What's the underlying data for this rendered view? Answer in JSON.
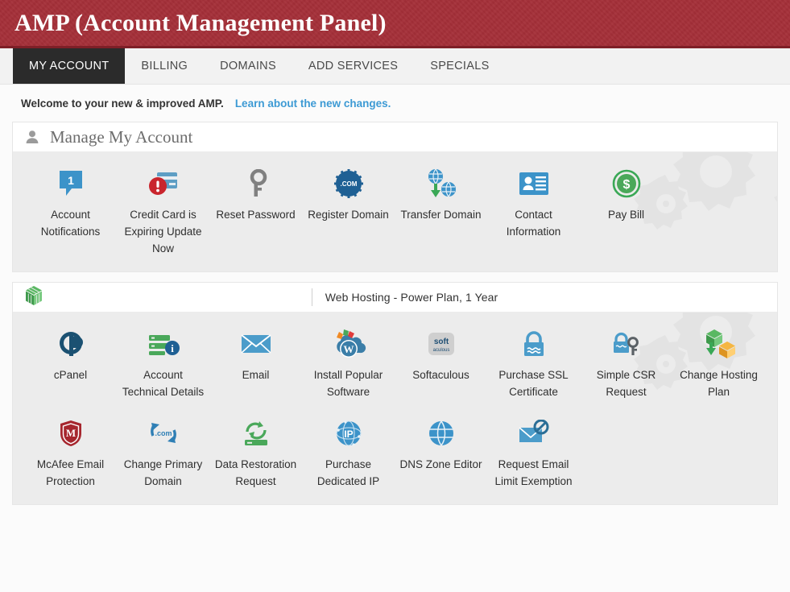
{
  "header": {
    "title": "AMP (Account Management Panel)",
    "bg_color": "#a42f38"
  },
  "nav": {
    "tabs": [
      {
        "label": "MY ACCOUNT",
        "active": true
      },
      {
        "label": "BILLING",
        "active": false
      },
      {
        "label": "DOMAINS",
        "active": false
      },
      {
        "label": "ADD SERVICES",
        "active": false
      },
      {
        "label": "SPECIALS",
        "active": false
      }
    ]
  },
  "welcome": {
    "text": "Welcome to your new & improved AMP.",
    "link": "Learn about the new changes.",
    "link_color": "#3d9ad4"
  },
  "account_panel": {
    "heading": "Manage My Account",
    "heading_icon": "person-icon",
    "tiles": [
      {
        "label": "Account Notifications",
        "icon": "notification-bubble-icon",
        "badge": "1"
      },
      {
        "label": "Credit Card is Expiring Update Now",
        "icon": "credit-card-alert-icon"
      },
      {
        "label": "Reset Password",
        "icon": "key-icon"
      },
      {
        "label": "Register Domain",
        "icon": "dot-com-badge-icon",
        "badge_text": ".COM"
      },
      {
        "label": "Transfer Domain",
        "icon": "transfer-domain-icon"
      },
      {
        "label": "Contact Information",
        "icon": "id-card-icon"
      },
      {
        "label": "Pay Bill",
        "icon": "dollar-coin-icon",
        "badge_text": "$"
      }
    ]
  },
  "hosting_panel": {
    "heading_icon": "green-cube-icon",
    "plan": "Web Hosting - Power Plan, 1 Year",
    "tiles_row1": [
      {
        "label": "cPanel",
        "icon": "cpanel-logo-icon"
      },
      {
        "label": "Account Technical Details",
        "icon": "server-info-icon"
      },
      {
        "label": "Email",
        "icon": "envelope-icon"
      },
      {
        "label": "Install Popular Software",
        "icon": "wordpress-cloud-icon"
      },
      {
        "label": "Softaculous",
        "icon": "softaculous-icon",
        "badge_text": "soft"
      },
      {
        "label": "Purchase SSL Certificate",
        "icon": "padlock-icon"
      },
      {
        "label": "Simple CSR Request",
        "icon": "padlock-key-icon"
      },
      {
        "label": "Change Hosting Plan",
        "icon": "change-plan-cubes-icon"
      }
    ],
    "tiles_row2": [
      {
        "label": "McAfee Email Protection",
        "icon": "mcafee-shield-icon",
        "badge_text": "M"
      },
      {
        "label": "Change Primary Domain",
        "icon": "refresh-domain-icon",
        "badge_text": ".com"
      },
      {
        "label": "Data Restoration Request",
        "icon": "restore-server-icon"
      },
      {
        "label": "Purchase Dedicated IP",
        "icon": "ip-globe-icon",
        "badge_text": "IP"
      },
      {
        "label": "DNS Zone Editor",
        "icon": "globe-icon"
      },
      {
        "label": "Request Email Limit Exemption",
        "icon": "blocked-email-icon"
      }
    ]
  },
  "colors": {
    "brand_red": "#a42f38",
    "accent_blue": "#3d9ad4",
    "icon_blue": "#3c93c9",
    "icon_dark_blue": "#1f6094",
    "icon_green": "#4aa85a",
    "icon_orange": "#f0a93c",
    "alert_red": "#c9252d",
    "panel_bg": "#ececec"
  }
}
